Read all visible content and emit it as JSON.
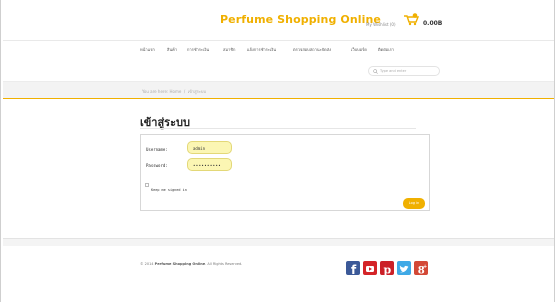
{
  "header": {
    "title": "Perfume Shopping Online",
    "wishlist": "My Wishlist (0)",
    "cart_total": "0.00B"
  },
  "nav": {
    "items": [
      "หน้าแรก",
      "สินค้า",
      "การชำระเงิน",
      "สมาชิก",
      "แจ้งการชำระเงิน",
      "ตรวจสอบสถานะจัดส่ง",
      "เว็บบอร์ด",
      "ติดต่อเรา"
    ]
  },
  "search": {
    "placeholder": "Type and enter"
  },
  "breadcrumb": {
    "home": "You are here: Home",
    "separator": "/",
    "current": "เข้าสู่ระบบ"
  },
  "page": {
    "title": "เข้าสู่ระบบ"
  },
  "login": {
    "username_label": "Username:",
    "username_value": "admin",
    "password_label": "Password:",
    "password_value": "••••••••••",
    "keep_signed_in": "Keep me signed in",
    "submit": "Log in"
  },
  "footer": {
    "copyright_prefix": "© 2014",
    "site_name": "Perfume Shopping Online",
    "rights": ". All Rights Reserved.",
    "social": [
      "facebook-icon",
      "youtube-icon",
      "pinterest-icon",
      "twitter-icon",
      "googleplus-icon"
    ]
  },
  "colors": {
    "accent": "#f0b000",
    "input_bg": "#fbf6b3",
    "facebook": "#3b5998",
    "youtube": "#d42428",
    "pinterest": "#cb2027",
    "twitter": "#3fa9e6",
    "googleplus": "#d34836"
  }
}
